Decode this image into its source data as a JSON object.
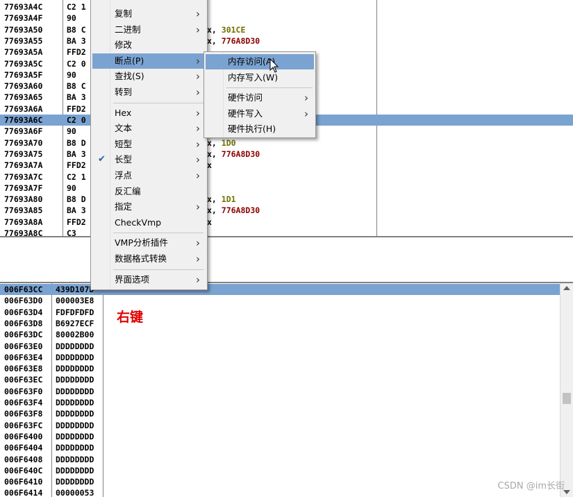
{
  "disasm": {
    "rows": [
      {
        "addr": "77693A4C",
        "bytes": "C2 1",
        "ops": "",
        "cls": ""
      },
      {
        "addr": "77693A4F",
        "bytes": "90",
        "ops": "",
        "cls": ""
      },
      {
        "addr": "77693A50",
        "bytes": "B8 C",
        "ops": "x, ",
        "val": "301CE",
        "vcls": "num"
      },
      {
        "addr": "77693A55",
        "bytes": "BA 3",
        "ops": "x, ",
        "val": "776A8D30",
        "vcls": "ptr"
      },
      {
        "addr": "77693A5A",
        "bytes": "FFD2",
        "ops": "",
        "cls": ""
      },
      {
        "addr": "77693A5C",
        "bytes": "C2 0",
        "ops": "",
        "cls": ""
      },
      {
        "addr": "77693A5F",
        "bytes": "90",
        "ops": "",
        "cls": ""
      },
      {
        "addr": "77693A60",
        "bytes": "B8 C",
        "ops": "",
        "cls": ""
      },
      {
        "addr": "77693A65",
        "bytes": "BA 3",
        "ops": "",
        "cls": ""
      },
      {
        "addr": "77693A6A",
        "bytes": "FFD2",
        "ops": "",
        "cls": ""
      },
      {
        "addr": "77693A6C",
        "bytes": "C2 0",
        "ops": "",
        "cls": "sel"
      },
      {
        "addr": "77693A6F",
        "bytes": "90",
        "ops": "",
        "cls": ""
      },
      {
        "addr": "77693A70",
        "bytes": "B8 D",
        "ops": "x, ",
        "val": "1D0",
        "vcls": "num"
      },
      {
        "addr": "77693A75",
        "bytes": "BA 3",
        "ops": "x, ",
        "val": "776A8D30",
        "vcls": "ptr"
      },
      {
        "addr": "77693A7A",
        "bytes": "FFD2",
        "ops": "x",
        "cls": ""
      },
      {
        "addr": "77693A7C",
        "bytes": "C2 1",
        "ops": "",
        "cls": ""
      },
      {
        "addr": "77693A7F",
        "bytes": "90",
        "ops": "",
        "cls": ""
      },
      {
        "addr": "77693A80",
        "bytes": "B8 D",
        "ops": "x, ",
        "val": "1D1",
        "vcls": "num"
      },
      {
        "addr": "77693A85",
        "bytes": "BA 3",
        "ops": "x, ",
        "val": "776A8D30",
        "vcls": "ptr"
      },
      {
        "addr": "77693A8A",
        "bytes": "FFD2",
        "ops": "x",
        "cls": ""
      },
      {
        "addr": "77693A8C",
        "bytes": "C3",
        "ops": "",
        "cls": ""
      }
    ]
  },
  "stack": {
    "rows": [
      {
        "addr": "006F63CC",
        "val": "439D107D",
        "cls": "sel"
      },
      {
        "addr": "006F63D0",
        "val": "000003E8"
      },
      {
        "addr": "006F63D4",
        "val": "FDFDFDFD"
      },
      {
        "addr": "006F63D8",
        "val": "B6927ECF"
      },
      {
        "addr": "006F63DC",
        "val": "80002B00"
      },
      {
        "addr": "006F63E0",
        "val": "DDDDDDDD"
      },
      {
        "addr": "006F63E4",
        "val": "DDDDDDDD"
      },
      {
        "addr": "006F63E8",
        "val": "DDDDDDDD"
      },
      {
        "addr": "006F63EC",
        "val": "DDDDDDDD"
      },
      {
        "addr": "006F63F0",
        "val": "DDDDDDDD"
      },
      {
        "addr": "006F63F4",
        "val": "DDDDDDDD"
      },
      {
        "addr": "006F63F8",
        "val": "DDDDDDDD"
      },
      {
        "addr": "006F63FC",
        "val": "DDDDDDDD"
      },
      {
        "addr": "006F6400",
        "val": "DDDDDDDD"
      },
      {
        "addr": "006F6404",
        "val": "DDDDDDDD"
      },
      {
        "addr": "006F6408",
        "val": "DDDDDDDD"
      },
      {
        "addr": "006F640C",
        "val": "DDDDDDDD"
      },
      {
        "addr": "006F6410",
        "val": "DDDDDDDD"
      },
      {
        "addr": "006F6414",
        "val": "00000053"
      }
    ]
  },
  "annotation": "右键",
  "watermark": "CSDN @im长街",
  "context_menu": {
    "items": [
      {
        "label": "复制",
        "arrow": true
      },
      {
        "label": "二进制",
        "arrow": true
      },
      {
        "label": "修改",
        "arrow": false
      },
      {
        "label": "断点(P)",
        "arrow": true,
        "hover": true
      },
      {
        "label": "查找(S)",
        "arrow": true
      },
      {
        "label": "转到",
        "arrow": true
      },
      {
        "sep": true
      },
      {
        "label": "Hex",
        "arrow": true
      },
      {
        "label": "文本",
        "arrow": true
      },
      {
        "label": "短型",
        "arrow": true
      },
      {
        "label": "长型",
        "arrow": true,
        "checked": true
      },
      {
        "label": "浮点",
        "arrow": true
      },
      {
        "label": "反汇编",
        "arrow": false
      },
      {
        "label": "指定",
        "arrow": true
      },
      {
        "label": "CheckVmp",
        "arrow": false
      },
      {
        "sep": true
      },
      {
        "label": "VMP分析插件",
        "arrow": true
      },
      {
        "label": "数据格式转换",
        "arrow": true
      },
      {
        "sep": true
      },
      {
        "label": "界面选项",
        "arrow": true
      }
    ]
  },
  "breakpoint_submenu": {
    "items": [
      {
        "label": "内存访问(A)",
        "arrow": false,
        "hover": true
      },
      {
        "label": "内存写入(W)",
        "arrow": false
      },
      {
        "sep": true
      },
      {
        "label": "硬件访问",
        "arrow": true
      },
      {
        "label": "硬件写入",
        "arrow": true
      },
      {
        "label": "硬件执行(H)",
        "arrow": false
      }
    ]
  },
  "icons": {
    "submenu_arrow": "chevron-right-icon",
    "checkmark": "check-icon",
    "cursor": "mouse-pointer-icon"
  },
  "colors": {
    "selection": "#7ba3d1",
    "number": "#707000",
    "pointer": "#8b0000",
    "annotation": "#e00000"
  }
}
